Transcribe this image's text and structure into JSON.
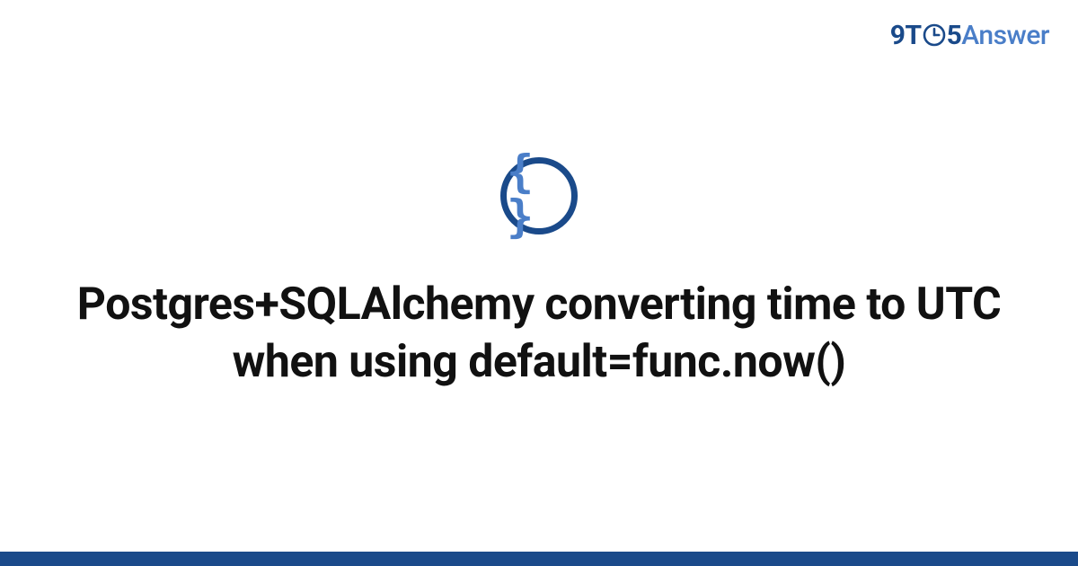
{
  "brand": {
    "nine": "9",
    "t": "T",
    "five": "5",
    "answer": "Answer"
  },
  "icon": {
    "braces": "{ }"
  },
  "title": "Postgres+SQLAlchemy converting time to UTC when using default=func.now()",
  "colors": {
    "brand_dark": "#1a4a8a",
    "brand_light": "#4a7ec8"
  }
}
